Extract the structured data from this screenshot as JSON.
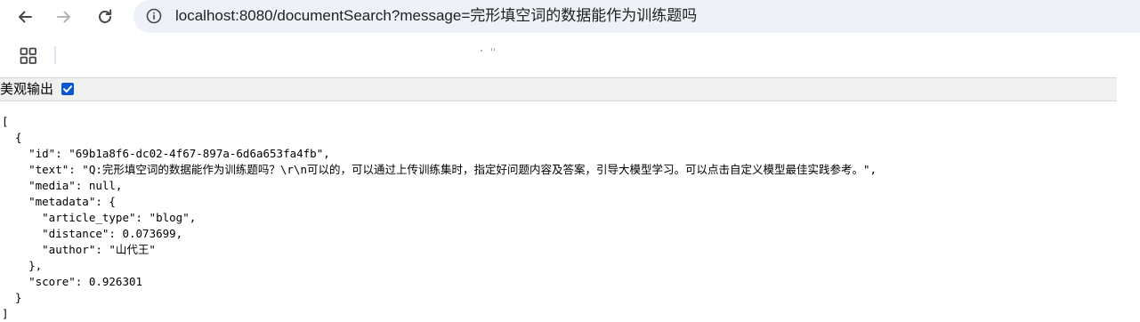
{
  "browser": {
    "url": "localhost:8080/documentSearch?message=完形填空词的数据能作为训练题吗"
  },
  "viewer": {
    "pretty_print_label": "美观输出",
    "pretty_print_checked": true
  },
  "json_lines": {
    "l01": "[",
    "l02": "  {",
    "l03": "    \"id\": \"69b1a8f6-dc02-4f67-897a-6d6a653fa4fb\",",
    "l04": "    \"text\": \"Q:完形填空词的数据能作为训练题吗？\\r\\n可以的，可以通过上传训练集时，指定好问题内容及答案，引导大模型学习。可以点击自定义模型最佳实践参考。\",",
    "l05": "    \"media\": null,",
    "l06": "    \"metadata\": {",
    "l07": "      \"article_type\": \"blog\",",
    "l08": "      \"distance\": 0.073699,",
    "l09": "      \"author\": \"山代王\"",
    "l10": "    },",
    "l11": "    \"score\": 0.926301",
    "l12": "  }",
    "l13": "]"
  },
  "colors": {
    "omnibox_bg": "#eef1f8",
    "checkbox_accent": "#0b57d0",
    "options_bar_bg": "#f0f0f0"
  },
  "icons": {
    "back": "arrow-left-icon",
    "forward": "arrow-right-icon",
    "reload": "reload-icon",
    "site_info": "site-info-icon",
    "apps": "apps-grid-icon",
    "checkbox": "checkmark-icon"
  }
}
